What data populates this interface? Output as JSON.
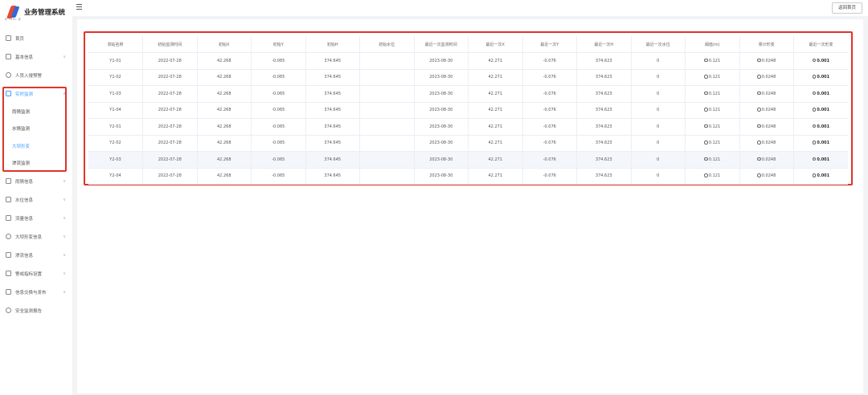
{
  "app": {
    "title": "业务管理系统",
    "logo_sub": "智 ARBC 惠"
  },
  "topbar": {
    "back_label": "返回首页"
  },
  "sidebar": {
    "items": [
      {
        "label": "首页",
        "icon": "home-icon",
        "has_children": false
      },
      {
        "label": "基本信息",
        "icon": "document-icon",
        "has_children": true
      },
      {
        "label": "人员入侵预警",
        "icon": "alert-icon",
        "has_children": false
      },
      {
        "label": "实时监测",
        "icon": "monitor-icon",
        "has_children": true,
        "active": true
      },
      {
        "label": "雨情信息",
        "icon": "cloud-icon",
        "has_children": true
      },
      {
        "label": "水位信息",
        "icon": "water-icon",
        "has_children": true
      },
      {
        "label": "流量信息",
        "icon": "flow-icon",
        "has_children": true
      },
      {
        "label": "大坝形变信息",
        "icon": "dam-icon",
        "has_children": true
      },
      {
        "label": "渗流信息",
        "icon": "seepage-icon",
        "has_children": true
      },
      {
        "label": "警戒指标设置",
        "icon": "settings-icon",
        "has_children": true
      },
      {
        "label": "信息交换与发布",
        "icon": "mail-icon",
        "has_children": true
      },
      {
        "label": "安全监测报告",
        "icon": "report-icon",
        "has_children": false
      }
    ],
    "submenu": [
      {
        "label": "雨情监测",
        "selected": false
      },
      {
        "label": "水情监测",
        "selected": false
      },
      {
        "label": "大坝形变",
        "selected": true
      },
      {
        "label": "渗流监测",
        "selected": false
      }
    ]
  },
  "table": {
    "columns": [
      "测站名称",
      "初始监测时间",
      "初始X",
      "初始Y",
      "初始H",
      "初始水位",
      "最近一次监测时间",
      "最近一次X",
      "最近一次Y",
      "最近一次H",
      "最近一次水位",
      "阈值(m)",
      "累计形变",
      "最近一次形变"
    ],
    "rows": [
      [
        "Y1-01",
        "2022-07-28",
        "42.268",
        "-0.065",
        "374.645",
        "",
        "2023-08-30",
        "42.271",
        "-0.076",
        "374.623",
        "0",
        "0.121",
        "0.0248",
        "0.001"
      ],
      [
        "Y1-02",
        "2022-07-28",
        "42.268",
        "-0.065",
        "374.645",
        "",
        "2023-08-30",
        "42.271",
        "-0.076",
        "374.623",
        "0",
        "0.121",
        "0.0248",
        "0.001"
      ],
      [
        "Y1-03",
        "2022-07-28",
        "42.268",
        "-0.065",
        "374.645",
        "",
        "2023-08-30",
        "42.271",
        "-0.076",
        "374.623",
        "0",
        "0.121",
        "0.0248",
        "0.001"
      ],
      [
        "Y1-04",
        "2022-07-28",
        "42.268",
        "-0.065",
        "374.645",
        "",
        "2023-08-30",
        "42.271",
        "-0.076",
        "374.623",
        "0",
        "0.121",
        "0.0248",
        "0.001"
      ],
      [
        "Y2-01",
        "2022-07-28",
        "42.268",
        "-0.065",
        "374.645",
        "",
        "2023-08-30",
        "42.271",
        "-0.076",
        "374.623",
        "0",
        "0.121",
        "0.0248",
        "0.001"
      ],
      [
        "Y2-02",
        "2022-07-28",
        "42.268",
        "-0.065",
        "374.645",
        "",
        "2023-08-30",
        "42.271",
        "-0.076",
        "374.623",
        "0",
        "0.121",
        "0.0248",
        "0.001"
      ],
      [
        "Y2-03",
        "2022-07-28",
        "42.268",
        "-0.065",
        "374.645",
        "",
        "2023-08-30",
        "42.271",
        "-0.076",
        "374.623",
        "0",
        "0.121",
        "0.0248",
        "0.001"
      ],
      [
        "Y2-04",
        "2022-07-28",
        "42.268",
        "-0.065",
        "374.645",
        "",
        "2023-08-30",
        "42.271",
        "-0.076",
        "374.623",
        "0",
        "0.121",
        "0.0248",
        "0.001"
      ]
    ],
    "striped_row_index": 6
  },
  "colors": {
    "accent": "#409eff",
    "highlight": "#e0342a"
  }
}
